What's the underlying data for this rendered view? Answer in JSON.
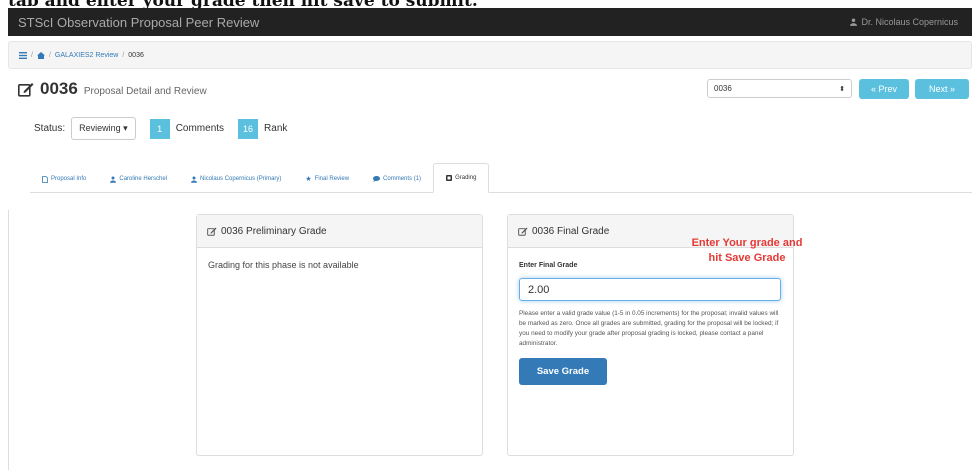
{
  "caption_fragment": "tab and enter your grade then hit save to submit.",
  "navbar": {
    "brand": "STScI Observation Proposal Peer Review",
    "user": "Dr. Nicolaus Copernicus"
  },
  "breadcrumb": {
    "sep": "/",
    "review": "GALAXIES2 Review",
    "current": "0036"
  },
  "title": {
    "number": "0036",
    "subtitle": "Proposal Detail and Review"
  },
  "proposal_select": {
    "value": "0036"
  },
  "nav_buttons": {
    "prev": "« Prev",
    "next": "Next »"
  },
  "status": {
    "label": "Status:",
    "value": "Reviewing ▾",
    "comments_count": "1",
    "comments_label": "Comments",
    "rank_value": "16",
    "rank_label": "Rank"
  },
  "tabs": [
    {
      "label": "Proposal Info",
      "icon": "document-icon"
    },
    {
      "label": "Caroline Herschel",
      "icon": "user-icon"
    },
    {
      "label": "Nicolaus Copernicus (Primary)",
      "icon": "user-icon"
    },
    {
      "label": "Final Review",
      "icon": "star-icon"
    },
    {
      "label": "Comments (1)",
      "icon": "comment-icon"
    },
    {
      "label": "Grading",
      "icon": "grading-icon"
    }
  ],
  "preliminary": {
    "title": "0036 Preliminary Grade",
    "message": "Grading for this phase is not available"
  },
  "final": {
    "title": "0036 Final Grade",
    "input_label": "Enter Final Grade",
    "input_value": "2.00",
    "help": "Please enter a valid grade value (1-5 in 0.05 increments) for the proposal; invalid values will be marked as zero. Once all grades are submitted, grading for the proposal will be locked; if you need to modify your grade after proposal grading is locked, please contact a panel administrator.",
    "save_label": "Save Grade"
  },
  "annotation": {
    "line1": "Enter Your grade and",
    "line2": "hit Save Grade"
  },
  "colors": {
    "navbar": "#222222",
    "info": "#5bc0de",
    "primary": "#337ab7",
    "annotation": "#e53935"
  }
}
